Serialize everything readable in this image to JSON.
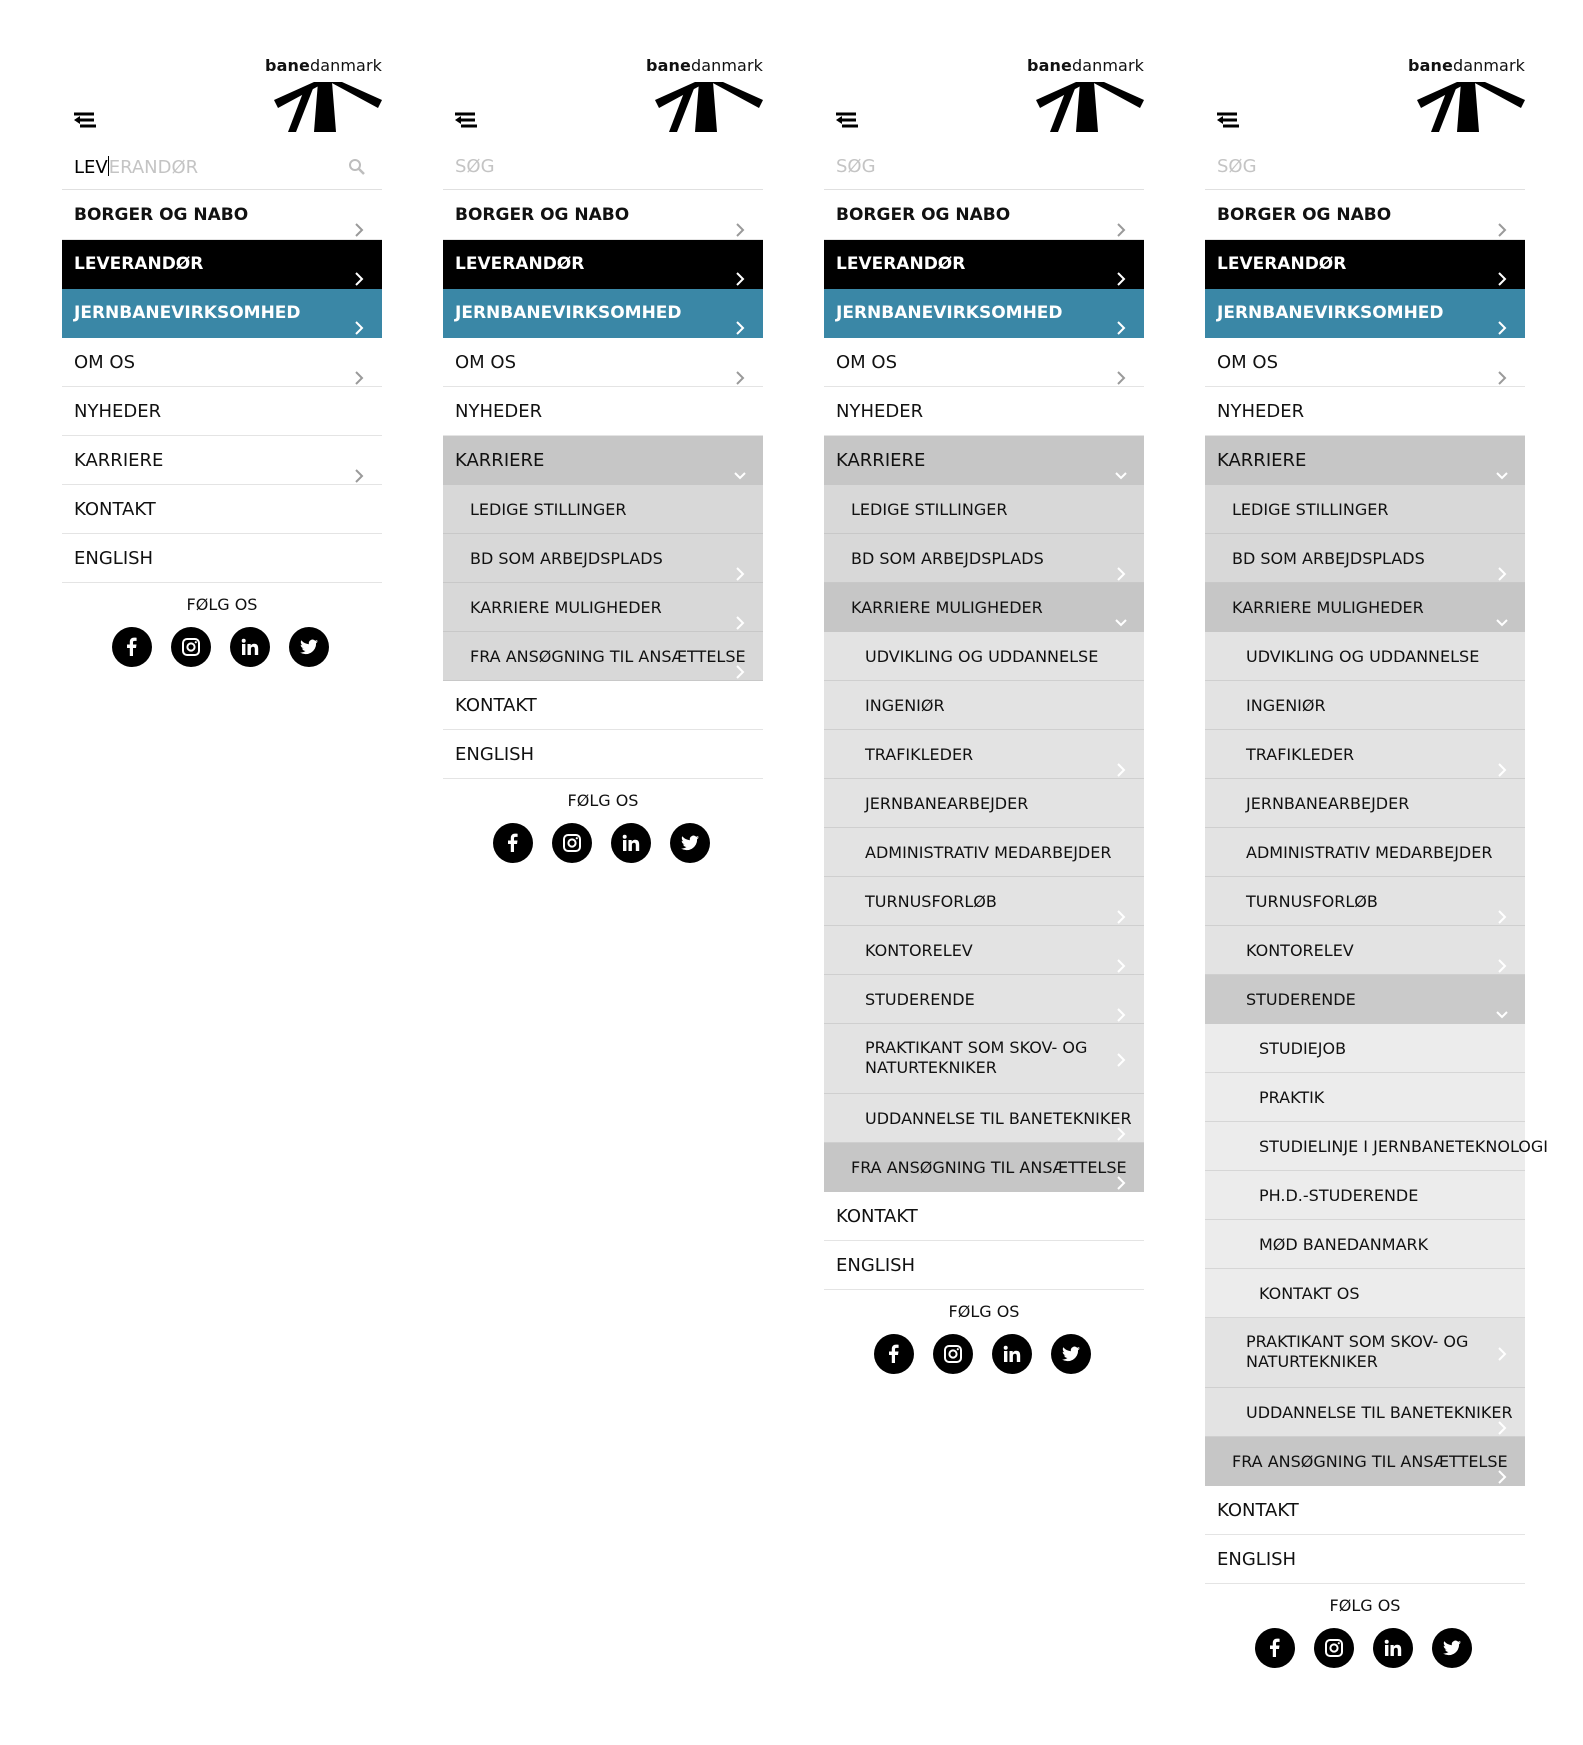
{
  "brand": {
    "logo_bold": "bane",
    "logo_regular": "danmark"
  },
  "panels": [
    {
      "search": {
        "typed": "LEV",
        "placeholder": "LEVERANDØR"
      },
      "items": [
        "BORGER OG NABO",
        "LEVERANDØR",
        "JERNBANEVIRKSOMHED",
        "OM OS",
        "NYHEDER",
        "KARRIERE",
        "KONTAKT",
        "ENGLISH"
      ]
    },
    {
      "search": {
        "typed": "",
        "placeholder": "SØG"
      },
      "items": [
        "BORGER OG NABO",
        "LEVERANDØR",
        "JERNBANEVIRKSOMHED",
        "OM OS",
        "NYHEDER",
        "KARRIERE",
        "LEDIGE STILLINGER",
        "BD SOM ARBEJDSPLADS",
        "KARRIERE MULIGHEDER",
        "FRA ANSØGNING TIL ANSÆTTELSE",
        "KONTAKT",
        "ENGLISH"
      ]
    },
    {
      "search": {
        "typed": "",
        "placeholder": "SØG"
      },
      "items": [
        "BORGER OG NABO",
        "LEVERANDØR",
        "JERNBANEVIRKSOMHED",
        "OM OS",
        "NYHEDER",
        "KARRIERE",
        "LEDIGE STILLINGER",
        "BD SOM ARBEJDSPLADS",
        "KARRIERE MULIGHEDER",
        "UDVIKLING OG UDDANNELSE",
        "INGENIØR",
        "TRAFIKLEDER",
        "JERNBANEARBEJDER",
        "ADMINISTRATIV MEDARBEJDER",
        "TURNUSFORLØB",
        "KONTORELEV",
        "STUDERENDE",
        "PRAKTIKANT SOM SKOV- OG NATURTEKNIKER",
        "UDDANNELSE TIL BANETEKNIKER",
        "FRA ANSØGNING TIL ANSÆTTELSE",
        "KONTAKT",
        "ENGLISH"
      ]
    },
    {
      "search": {
        "typed": "",
        "placeholder": "SØG"
      },
      "items": [
        "BORGER OG NABO",
        "LEVERANDØR",
        "JERNBANEVIRKSOMHED",
        "OM OS",
        "NYHEDER",
        "KARRIERE",
        "LEDIGE STILLINGER",
        "BD SOM ARBEJDSPLADS",
        "KARRIERE MULIGHEDER",
        "UDVIKLING OG UDDANNELSE",
        "INGENIØR",
        "TRAFIKLEDER",
        "JERNBANEARBEJDER",
        "ADMINISTRATIV MEDARBEJDER",
        "TURNUSFORLØB",
        "KONTORELEV",
        "STUDERENDE",
        "STUDIEJOB",
        "PRAKTIK",
        "STUDIELINJE I JERNBANETEKNOLOGI",
        "PH.D.-STUDERENDE",
        "MØD BANEDANMARK",
        "KONTAKT OS",
        "PRAKTIKANT SOM SKOV- OG NATURTEKNIKER",
        "UDDANNELSE TIL BANETEKNIKER",
        "FRA ANSØGNING TIL ANSÆTTELSE",
        "KONTAKT",
        "ENGLISH"
      ]
    }
  ],
  "follow": {
    "label": "FØLG OS"
  },
  "social_icons": [
    "facebook-icon",
    "instagram-icon",
    "linkedin-icon",
    "twitter-icon"
  ],
  "colors": {
    "accent_blue": "#3a87a6",
    "active_black": "#000000",
    "submenu_gray": "#d8d8d8"
  }
}
